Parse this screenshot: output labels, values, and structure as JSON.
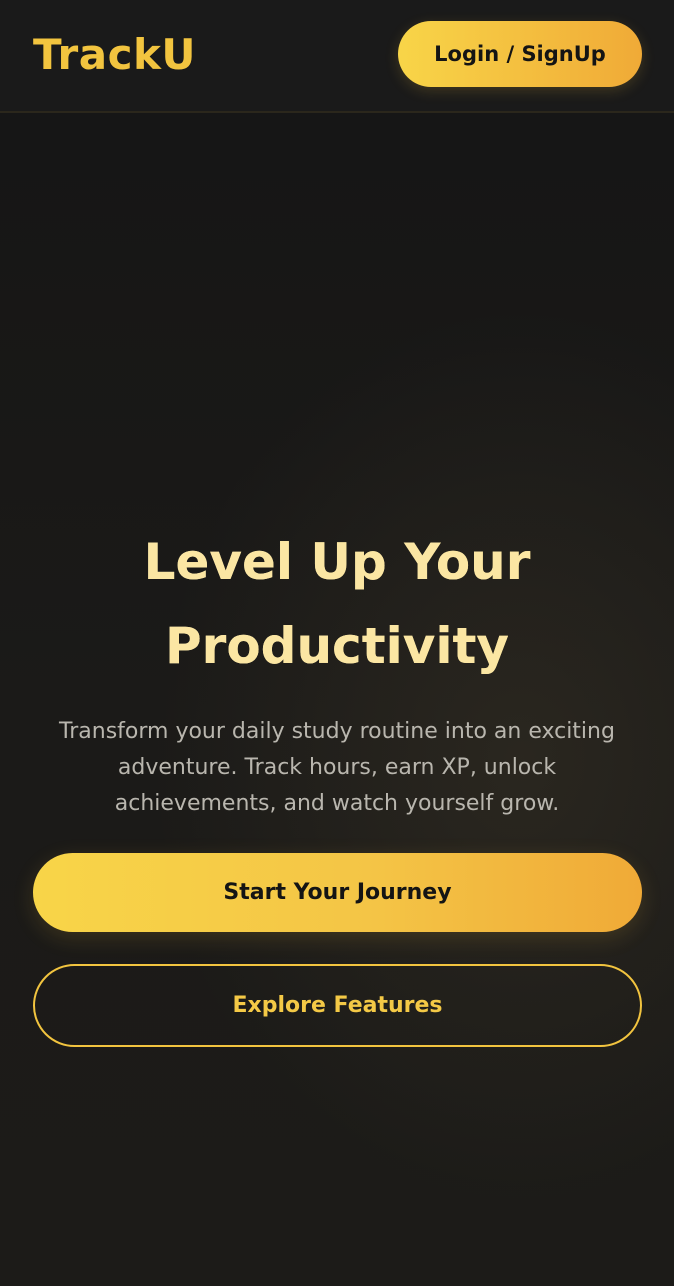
{
  "header": {
    "brand": "TrackU",
    "login_label": "Login / SignUp"
  },
  "hero": {
    "title_line1": "Level Up Your",
    "title_line2": "Productivity",
    "subtitle": "Transform your daily study routine into an exciting adventure. Track hours, earn XP, unlock achievements, and watch yourself grow.",
    "primary_cta": "Start Your Journey",
    "secondary_cta": "Explore Features"
  },
  "colors": {
    "accent": "#f2c43f",
    "accent_gradient_end": "#f0aa37",
    "background": "#161616",
    "title_text": "#fbe6a3",
    "body_text": "#b9b6ae"
  }
}
